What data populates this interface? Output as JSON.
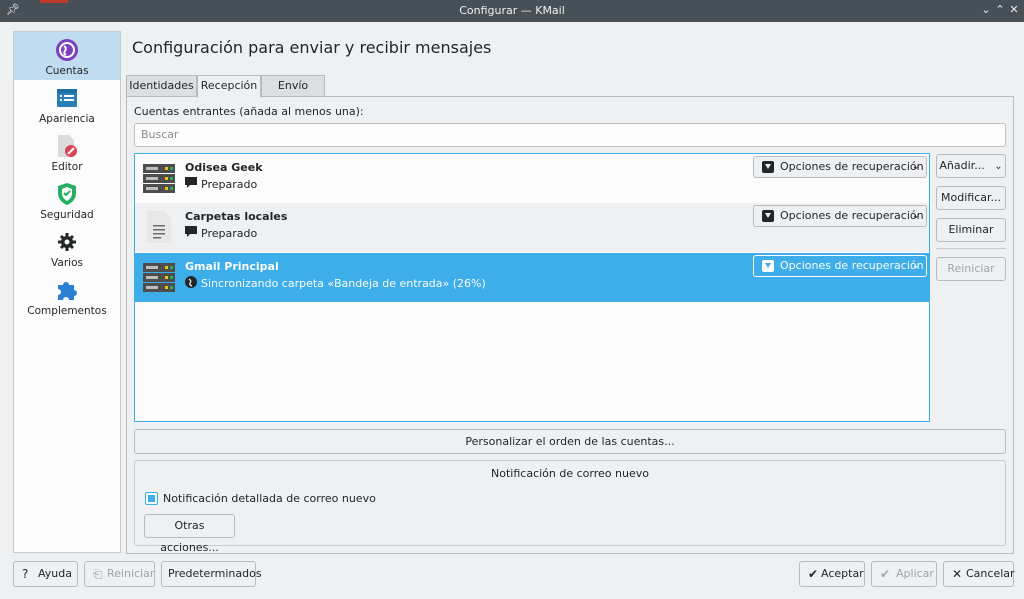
{
  "window": {
    "title": "Configurar — KMail"
  },
  "sidebar": {
    "items": [
      {
        "label": "Cuentas",
        "icon": "globe-icon"
      },
      {
        "label": "Apariencia",
        "icon": "appearance-icon"
      },
      {
        "label": "Editor",
        "icon": "editor-icon"
      },
      {
        "label": "Seguridad",
        "icon": "shield-icon"
      },
      {
        "label": "Varios",
        "icon": "gear-icon"
      },
      {
        "label": "Complementos",
        "icon": "puzzle-icon"
      }
    ]
  },
  "page": {
    "heading": "Configuración para enviar y recibir mensajes"
  },
  "tabs": [
    {
      "label": "Identidades"
    },
    {
      "label": "Recepción"
    },
    {
      "label": "Envío"
    }
  ],
  "incoming": {
    "label": "Cuentas entrantes (añada al menos una):",
    "search_placeholder": "Buscar",
    "accounts": [
      {
        "name": "Odisea Geek",
        "status": "Preparado",
        "options": "Opciones de recuperación"
      },
      {
        "name": "Carpetas locales",
        "status": "Preparado",
        "options": "Opciones de recuperación"
      },
      {
        "name": "Gmail Principal",
        "status": "Sincronizando carpeta «Bandeja de entrada» (26%)",
        "options": "Opciones de recuperación"
      }
    ],
    "buttons": {
      "add": "Añadir...",
      "modify": "Modificar...",
      "remove": "Eliminar",
      "restart": "Reiniciar"
    },
    "customize_order": "Personalizar el orden de las cuentas..."
  },
  "notification": {
    "title": "Notificación de correo nuevo",
    "detailed_label": "Notificación detallada de correo nuevo",
    "detailed_checked": true,
    "other_actions": "Otras acciones..."
  },
  "footer": {
    "help": "Ayuda",
    "reset": "Reiniciar",
    "defaults": "Predeterminados",
    "accept": "Aceptar",
    "apply": "Aplicar",
    "cancel": "Cancelar"
  },
  "colors": {
    "accent": "#3daee9",
    "titlebar": "#475057",
    "background": "#eff0f1"
  }
}
